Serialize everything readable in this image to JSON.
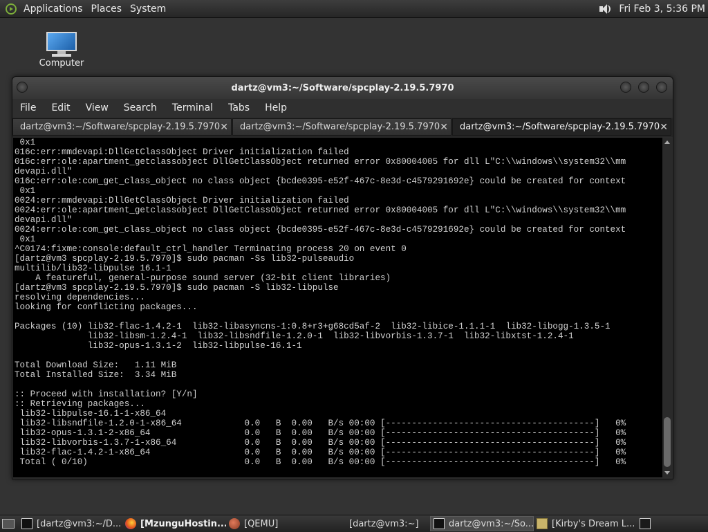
{
  "top_panel": {
    "menus": [
      "Applications",
      "Places",
      "System"
    ],
    "clock": "Fri Feb  3,  5:36 PM"
  },
  "desktop": {
    "computer_label": "Computer"
  },
  "window": {
    "title": "dartz@vm3:~/Software/spcplay-2.19.5.7970",
    "menus": [
      "File",
      "Edit",
      "View",
      "Search",
      "Terminal",
      "Tabs",
      "Help"
    ],
    "tabs": [
      {
        "label": "dartz@vm3:~/Software/spcplay-2.19.5.7970",
        "close": "✕"
      },
      {
        "label": "dartz@vm3:~/Software/spcplay-2.19.5.7970",
        "close": "✕"
      },
      {
        "label": "dartz@vm3:~/Software/spcplay-2.19.5.7970",
        "close": "✕"
      }
    ],
    "active_tab": 2
  },
  "terminal": {
    "lines": [
      " 0x1",
      "016c:err:mmdevapi:DllGetClassObject Driver initialization failed",
      "016c:err:ole:apartment_getclassobject DllGetClassObject returned error 0x80004005 for dll L\"C:\\\\windows\\\\system32\\\\mm",
      "devapi.dll\"",
      "016c:err:ole:com_get_class_object no class object {bcde0395-e52f-467c-8e3d-c4579291692e} could be created for context",
      " 0x1",
      "0024:err:mmdevapi:DllGetClassObject Driver initialization failed",
      "0024:err:ole:apartment_getclassobject DllGetClassObject returned error 0x80004005 for dll L\"C:\\\\windows\\\\system32\\\\mm",
      "devapi.dll\"",
      "0024:err:ole:com_get_class_object no class object {bcde0395-e52f-467c-8e3d-c4579291692e} could be created for context",
      " 0x1",
      "^C0174:fixme:console:default_ctrl_handler Terminating process 20 on event 0",
      "[dartz@vm3 spcplay-2.19.5.7970]$ sudo pacman -Ss lib32-pulseaudio",
      "multilib/lib32-libpulse 16.1-1",
      "    A featureful, general-purpose sound server (32-bit client libraries)",
      "[dartz@vm3 spcplay-2.19.5.7970]$ sudo pacman -S lib32-libpulse",
      "resolving dependencies...",
      "looking for conflicting packages...",
      "",
      "Packages (10) lib32-flac-1.4.2-1  lib32-libasyncns-1:0.8+r3+g68cd5af-2  lib32-libice-1.1.1-1  lib32-libogg-1.3.5-1",
      "              lib32-libsm-1.2.4-1  lib32-libsndfile-1.2.0-1  lib32-libvorbis-1.3.7-1  lib32-libxtst-1.2.4-1",
      "              lib32-opus-1.3.1-2  lib32-libpulse-16.1-1",
      "",
      "Total Download Size:   1.11 MiB",
      "Total Installed Size:  3.34 MiB",
      "",
      ":: Proceed with installation? [Y/n]",
      ":: Retrieving packages...",
      " lib32-libpulse-16.1-1-x86_64",
      " lib32-libsndfile-1.2.0-1-x86_64            0.0   B  0.00   B/s 00:00 [----------------------------------------]   0%",
      " lib32-opus-1.3.1-2-x86_64                  0.0   B  0.00   B/s 00:00 [----------------------------------------]   0%",
      " lib32-libvorbis-1.3.7-1-x86_64             0.0   B  0.00   B/s 00:00 [----------------------------------------]   0%",
      " lib32-flac-1.4.2-1-x86_64                  0.0   B  0.00   B/s 00:00 [----------------------------------------]   0%",
      " Total ( 0/10)                              0.0   B  0.00   B/s 00:00 [----------------------------------------]   0%"
    ]
  },
  "taskbar": {
    "tasks": [
      {
        "label": "[dartz@vm3:~/D...",
        "icon": "terminal-icon"
      },
      {
        "label": "[MzunguHostin...",
        "icon": "firefox-icon"
      },
      {
        "label": "[QEMU]",
        "icon": "qemu-icon"
      },
      {
        "label": "[dartz@vm3:~]",
        "icon": "terminal-icon"
      },
      {
        "label": "dartz@vm3:~/So...",
        "icon": "terminal-icon"
      },
      {
        "label": "[Kirby's Dream L...",
        "icon": "folder-icon"
      }
    ],
    "active_task": 4
  },
  "colors": {
    "panel_bg": "#2f2f2f",
    "desktop_bg": "#333333",
    "terminal_bg": "#000000",
    "terminal_fg": "#d2d2d2"
  }
}
